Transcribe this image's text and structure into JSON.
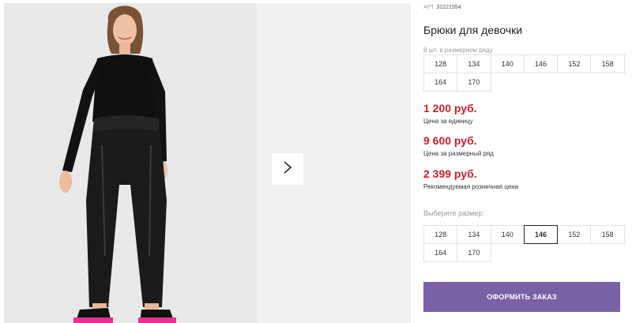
{
  "product": {
    "article_label": "АРТ.",
    "article_number": "32221554",
    "title": "Брюки для девочки",
    "pack_note": "8 шт. в размерном ряду"
  },
  "size_run": [
    "128",
    "134",
    "140",
    "146",
    "152",
    "158",
    "164",
    "170"
  ],
  "prices": [
    {
      "value": "1 200 руб.",
      "label": "Цена за единицу"
    },
    {
      "value": "9 600 руб.",
      "label": "Цена за размерный ряд"
    },
    {
      "value": "2 399 руб.",
      "label": "Рекомендуемая розничная цена"
    }
  ],
  "size_picker": {
    "label": "Выберите размер:",
    "sizes": [
      "128",
      "134",
      "140",
      "146",
      "152",
      "158",
      "164",
      "170"
    ],
    "selected": "146"
  },
  "order_button": "ОФОРМИТЬ ЗАКАЗ",
  "icons": {
    "next": "chevron-right-icon"
  },
  "colors": {
    "price": "#d11f2a",
    "order_button": "#7a61a6"
  }
}
